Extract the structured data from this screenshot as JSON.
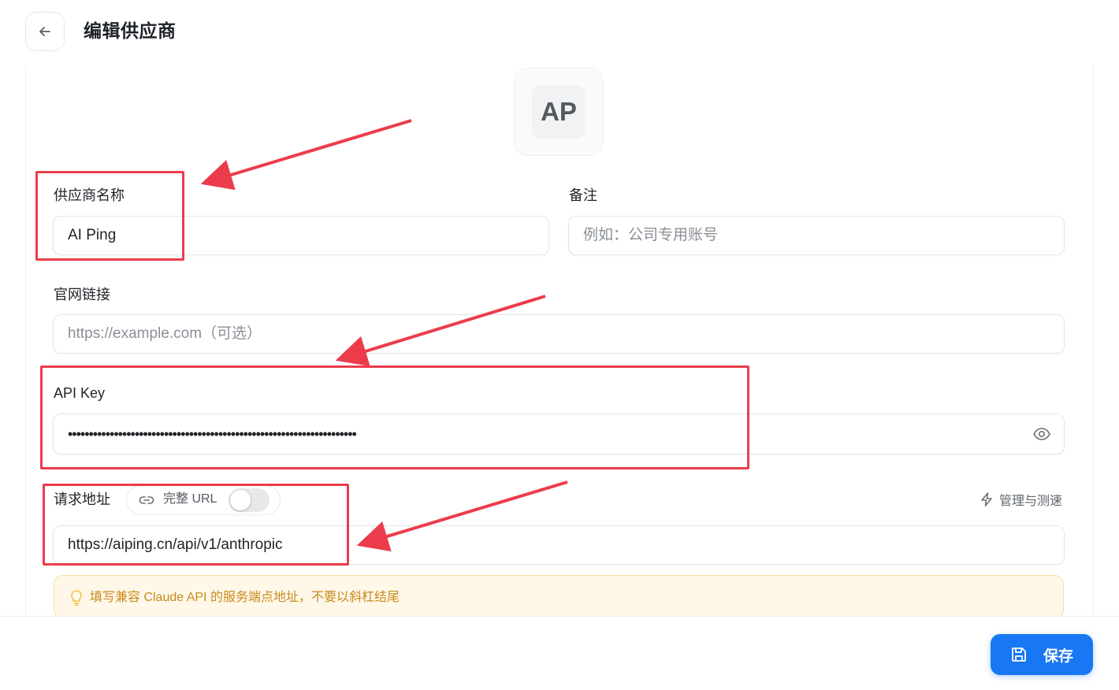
{
  "header": {
    "title": "编辑供应商",
    "back_icon": "arrow-left-icon"
  },
  "avatar": {
    "initials": "AP"
  },
  "form": {
    "provider_name": {
      "label": "供应商名称",
      "value": "AI Ping"
    },
    "note": {
      "label": "备注",
      "placeholder": "例如：公司专用账号"
    },
    "website": {
      "label": "官网链接",
      "placeholder": "https://example.com（可选）"
    },
    "api_key": {
      "label": "API Key",
      "masked_value": "•••••••••••••••••••••••••••••••••••••••••••••••••••••••••••••••••••••",
      "reveal_icon": "eye-icon"
    },
    "request_url": {
      "label": "请求地址",
      "full_url_toggle_label": "完整 URL",
      "full_url_toggle_icon": "link-icon",
      "full_url_enabled": false,
      "manage_label": "管理与测速",
      "manage_icon": "lightning-icon",
      "value": "https://aiping.cn/api/v1/anthropic"
    },
    "hint": {
      "text": "填写兼容 Claude API 的服务端点地址，不要以斜杠结尾",
      "icon": "lightbulb-icon"
    }
  },
  "footer": {
    "save_label": "保存",
    "save_icon": "save-icon"
  },
  "colors": {
    "accent": "#1877f2",
    "annotation": "#ec3c4b",
    "hint_bg": "#fff8e8",
    "hint_text": "#c98a1e"
  }
}
